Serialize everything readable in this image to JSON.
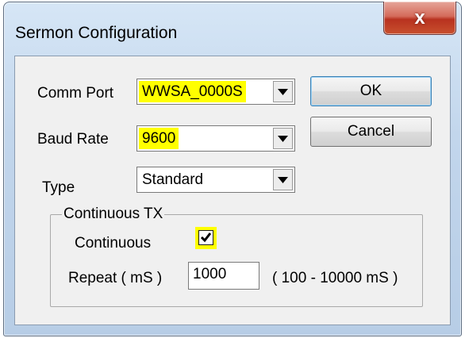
{
  "window": {
    "title": "Sermon Configuration",
    "close_label": "x"
  },
  "form": {
    "comm_port": {
      "label": "Comm Port",
      "value": "WWSA_0000S"
    },
    "baud_rate": {
      "label": "Baud Rate",
      "value": "9600"
    },
    "type": {
      "label": "Type",
      "value": "Standard"
    }
  },
  "buttons": {
    "ok_label": "OK",
    "cancel_label": "Cancel"
  },
  "continuous_group": {
    "legend": "Continuous TX",
    "continuous_label": "Continuous",
    "continuous_checked": true,
    "repeat_label": "Repeat ( mS )",
    "repeat_value": "1000",
    "repeat_range": "( 100 - 10000 mS )"
  },
  "highlight_color": "#ffff00",
  "icons": [
    "close-icon",
    "dropdown-arrow-icon",
    "checkmark-icon"
  ]
}
